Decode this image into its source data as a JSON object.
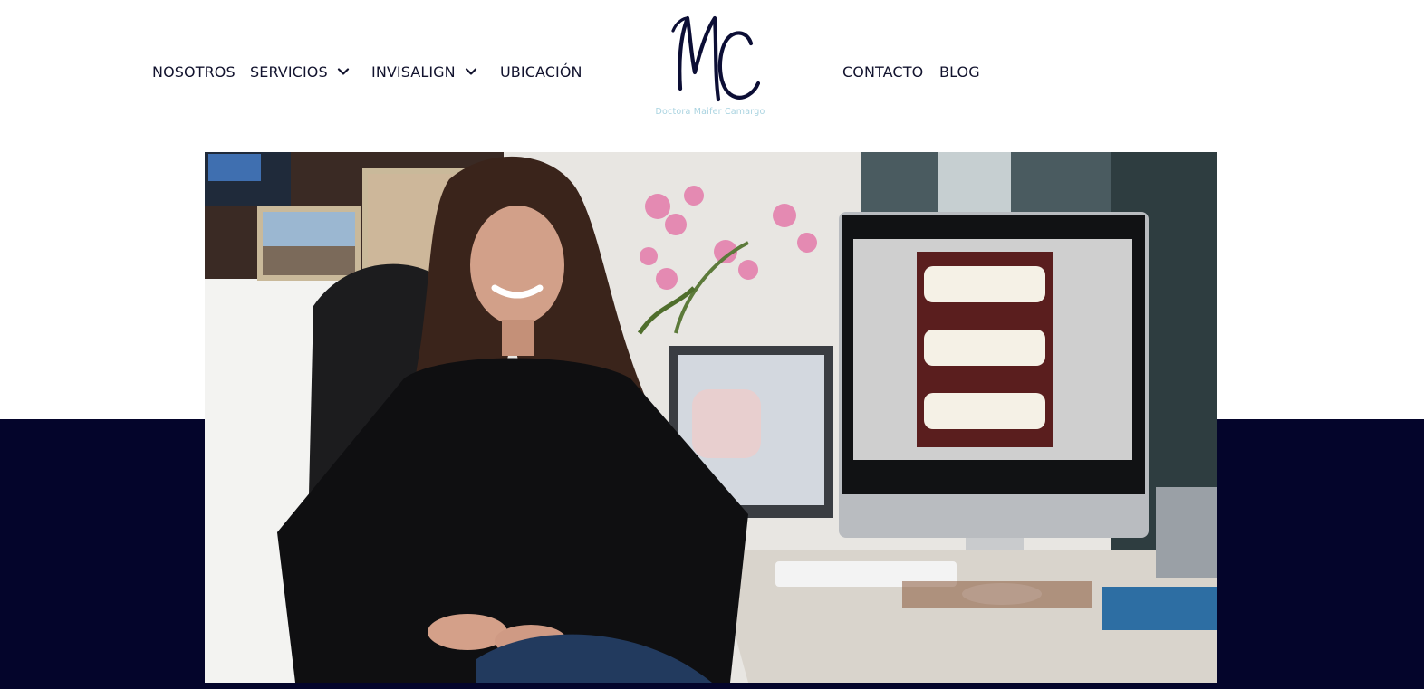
{
  "nav": {
    "left": [
      {
        "label": "NOSOTROS",
        "has_dropdown": false
      },
      {
        "label": "SERVICIOS",
        "has_dropdown": true
      },
      {
        "label": "INVISALIGN",
        "has_dropdown": true
      },
      {
        "label": "UBICACIÓN",
        "has_dropdown": false
      }
    ],
    "right": [
      {
        "label": "CONTACTO",
        "has_dropdown": false
      },
      {
        "label": "BLOG",
        "has_dropdown": false
      }
    ]
  },
  "logo": {
    "monogram": "MC",
    "caption": "Doctora Maifer Camargo"
  },
  "hero": {
    "icon": "portrait-photo"
  },
  "colors": {
    "navy": "#04052b",
    "nav_text": "#12132e",
    "logo_stroke": "#0c0e35",
    "logo_caption": "#a9d3e0",
    "background": "#ffffff"
  }
}
